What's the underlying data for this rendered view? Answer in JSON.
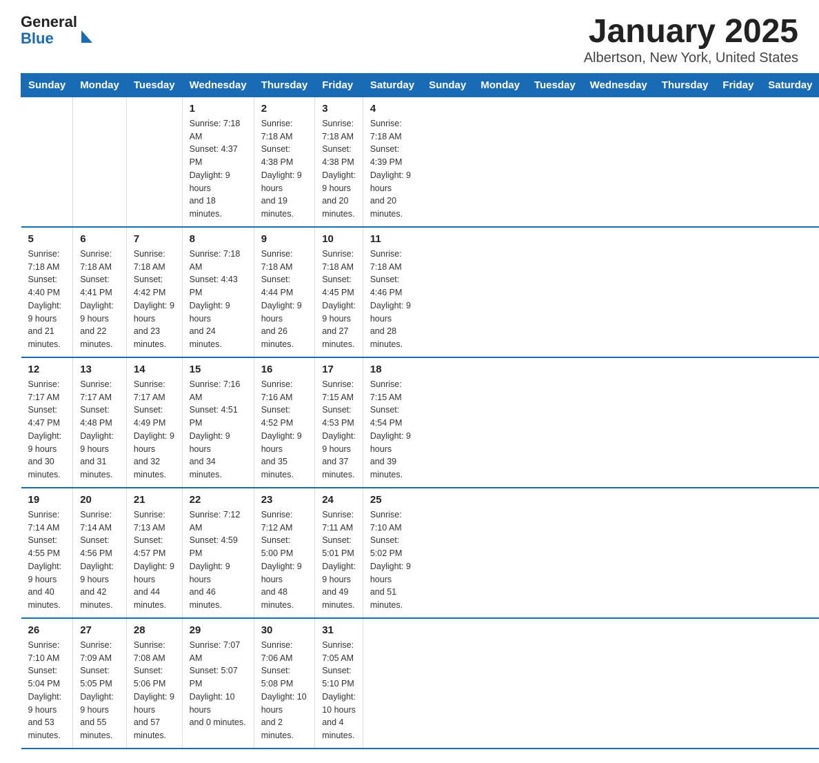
{
  "header": {
    "logo_general": "General",
    "logo_blue": "Blue",
    "title": "January 2025",
    "subtitle": "Albertson, New York, United States"
  },
  "days_of_week": [
    "Sunday",
    "Monday",
    "Tuesday",
    "Wednesday",
    "Thursday",
    "Friday",
    "Saturday"
  ],
  "weeks": [
    [
      {
        "day": "",
        "info": ""
      },
      {
        "day": "",
        "info": ""
      },
      {
        "day": "",
        "info": ""
      },
      {
        "day": "1",
        "info": "Sunrise: 7:18 AM\nSunset: 4:37 PM\nDaylight: 9 hours\nand 18 minutes."
      },
      {
        "day": "2",
        "info": "Sunrise: 7:18 AM\nSunset: 4:38 PM\nDaylight: 9 hours\nand 19 minutes."
      },
      {
        "day": "3",
        "info": "Sunrise: 7:18 AM\nSunset: 4:38 PM\nDaylight: 9 hours\nand 20 minutes."
      },
      {
        "day": "4",
        "info": "Sunrise: 7:18 AM\nSunset: 4:39 PM\nDaylight: 9 hours\nand 20 minutes."
      }
    ],
    [
      {
        "day": "5",
        "info": "Sunrise: 7:18 AM\nSunset: 4:40 PM\nDaylight: 9 hours\nand 21 minutes."
      },
      {
        "day": "6",
        "info": "Sunrise: 7:18 AM\nSunset: 4:41 PM\nDaylight: 9 hours\nand 22 minutes."
      },
      {
        "day": "7",
        "info": "Sunrise: 7:18 AM\nSunset: 4:42 PM\nDaylight: 9 hours\nand 23 minutes."
      },
      {
        "day": "8",
        "info": "Sunrise: 7:18 AM\nSunset: 4:43 PM\nDaylight: 9 hours\nand 24 minutes."
      },
      {
        "day": "9",
        "info": "Sunrise: 7:18 AM\nSunset: 4:44 PM\nDaylight: 9 hours\nand 26 minutes."
      },
      {
        "day": "10",
        "info": "Sunrise: 7:18 AM\nSunset: 4:45 PM\nDaylight: 9 hours\nand 27 minutes."
      },
      {
        "day": "11",
        "info": "Sunrise: 7:18 AM\nSunset: 4:46 PM\nDaylight: 9 hours\nand 28 minutes."
      }
    ],
    [
      {
        "day": "12",
        "info": "Sunrise: 7:17 AM\nSunset: 4:47 PM\nDaylight: 9 hours\nand 30 minutes."
      },
      {
        "day": "13",
        "info": "Sunrise: 7:17 AM\nSunset: 4:48 PM\nDaylight: 9 hours\nand 31 minutes."
      },
      {
        "day": "14",
        "info": "Sunrise: 7:17 AM\nSunset: 4:49 PM\nDaylight: 9 hours\nand 32 minutes."
      },
      {
        "day": "15",
        "info": "Sunrise: 7:16 AM\nSunset: 4:51 PM\nDaylight: 9 hours\nand 34 minutes."
      },
      {
        "day": "16",
        "info": "Sunrise: 7:16 AM\nSunset: 4:52 PM\nDaylight: 9 hours\nand 35 minutes."
      },
      {
        "day": "17",
        "info": "Sunrise: 7:15 AM\nSunset: 4:53 PM\nDaylight: 9 hours\nand 37 minutes."
      },
      {
        "day": "18",
        "info": "Sunrise: 7:15 AM\nSunset: 4:54 PM\nDaylight: 9 hours\nand 39 minutes."
      }
    ],
    [
      {
        "day": "19",
        "info": "Sunrise: 7:14 AM\nSunset: 4:55 PM\nDaylight: 9 hours\nand 40 minutes."
      },
      {
        "day": "20",
        "info": "Sunrise: 7:14 AM\nSunset: 4:56 PM\nDaylight: 9 hours\nand 42 minutes."
      },
      {
        "day": "21",
        "info": "Sunrise: 7:13 AM\nSunset: 4:57 PM\nDaylight: 9 hours\nand 44 minutes."
      },
      {
        "day": "22",
        "info": "Sunrise: 7:12 AM\nSunset: 4:59 PM\nDaylight: 9 hours\nand 46 minutes."
      },
      {
        "day": "23",
        "info": "Sunrise: 7:12 AM\nSunset: 5:00 PM\nDaylight: 9 hours\nand 48 minutes."
      },
      {
        "day": "24",
        "info": "Sunrise: 7:11 AM\nSunset: 5:01 PM\nDaylight: 9 hours\nand 49 minutes."
      },
      {
        "day": "25",
        "info": "Sunrise: 7:10 AM\nSunset: 5:02 PM\nDaylight: 9 hours\nand 51 minutes."
      }
    ],
    [
      {
        "day": "26",
        "info": "Sunrise: 7:10 AM\nSunset: 5:04 PM\nDaylight: 9 hours\nand 53 minutes."
      },
      {
        "day": "27",
        "info": "Sunrise: 7:09 AM\nSunset: 5:05 PM\nDaylight: 9 hours\nand 55 minutes."
      },
      {
        "day": "28",
        "info": "Sunrise: 7:08 AM\nSunset: 5:06 PM\nDaylight: 9 hours\nand 57 minutes."
      },
      {
        "day": "29",
        "info": "Sunrise: 7:07 AM\nSunset: 5:07 PM\nDaylight: 10 hours\nand 0 minutes."
      },
      {
        "day": "30",
        "info": "Sunrise: 7:06 AM\nSunset: 5:08 PM\nDaylight: 10 hours\nand 2 minutes."
      },
      {
        "day": "31",
        "info": "Sunrise: 7:05 AM\nSunset: 5:10 PM\nDaylight: 10 hours\nand 4 minutes."
      },
      {
        "day": "",
        "info": ""
      }
    ]
  ]
}
